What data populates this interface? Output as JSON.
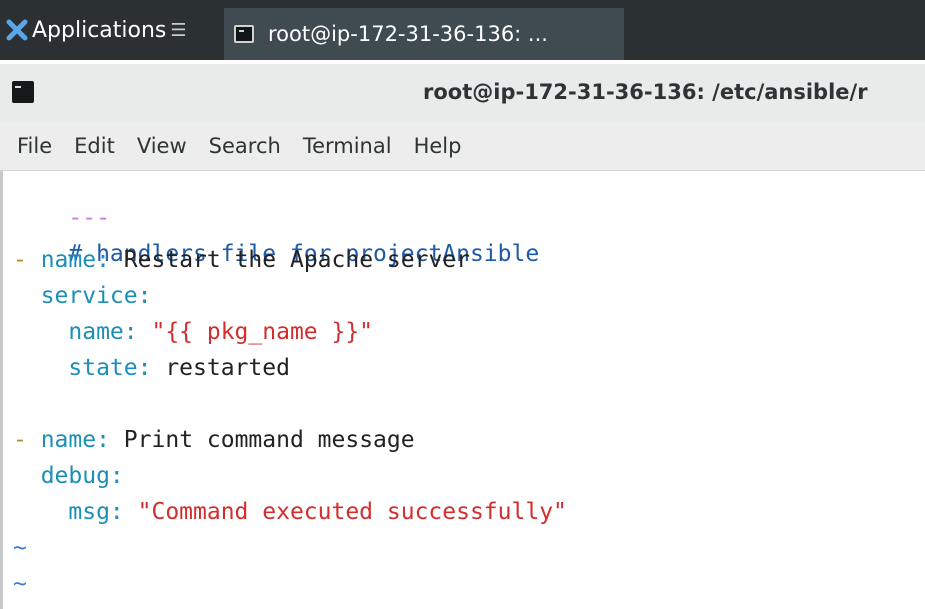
{
  "panel": {
    "apps_label": "Applications",
    "task_title": "root@ip-172-31-36-136: ..."
  },
  "window": {
    "title": "root@ip-172-31-36-136: /etc/ansible/r"
  },
  "menu": {
    "file": "File",
    "edit": "Edit",
    "view": "View",
    "search": "Search",
    "terminal": "Terminal",
    "help": "Help"
  },
  "editor": {
    "line1": "---",
    "line2": "# handlers file for projectAnsible",
    "line3_dash": "- ",
    "line3_key": "name:",
    "line3_val": " Restart the Apache server",
    "line4_key": "  service:",
    "line5_key": "    name:",
    "line5_val": " \"{{ pkg_name }}\"",
    "line6_key": "    state:",
    "line6_val": " restarted",
    "line8_dash": "- ",
    "line8_key": "name:",
    "line8_val": " Print command message",
    "line9_key": "  debug:",
    "line10_key": "    msg:",
    "line10_val": " \"Command executed successfully\"",
    "tilde1": "~",
    "tilde2": "~"
  }
}
